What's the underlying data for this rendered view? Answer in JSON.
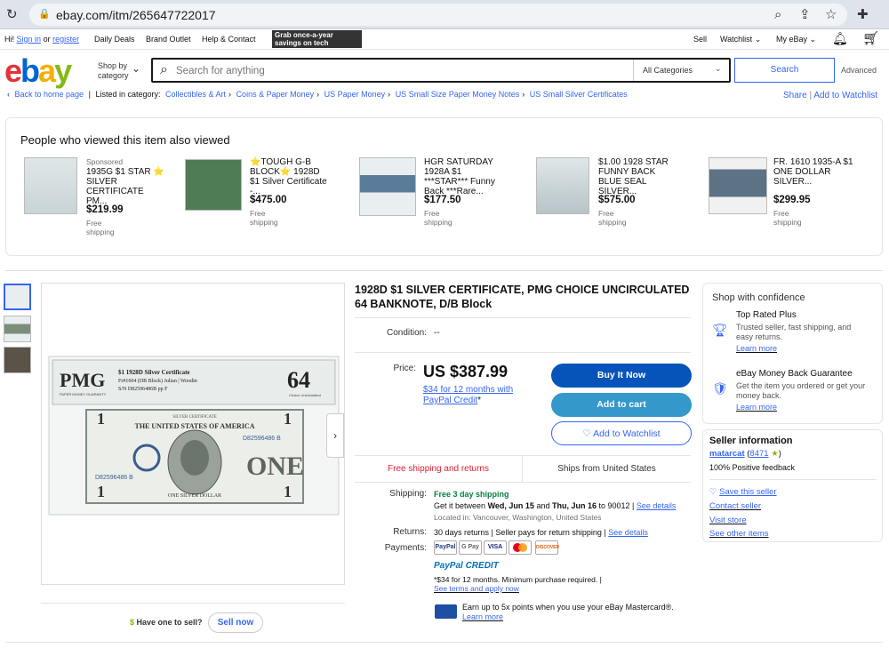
{
  "browser": {
    "url": "ebay.com/itm/265647722017"
  },
  "topnav": {
    "greeting": "Hi!",
    "sign_in": "Sign in",
    "or": "or",
    "register": "register",
    "daily_deals": "Daily Deals",
    "brand_outlet": "Brand Outlet",
    "help_contact": "Help & Contact",
    "promo_line1": "Grab once-a-year",
    "promo_line2": "savings on tech",
    "sell": "Sell",
    "watchlist": "Watchlist",
    "my_ebay": "My eBay"
  },
  "header": {
    "logo_letters": [
      "e",
      "b",
      "a",
      "y"
    ],
    "logo_colors": [
      "#e53238",
      "#0064d2",
      "#f5af02",
      "#86b817"
    ],
    "shop_by": "Shop by",
    "category": "category",
    "search_placeholder": "Search for anything",
    "all_categories": "All Categories",
    "search_button": "Search",
    "advanced": "Advanced"
  },
  "breadcrumbs": {
    "back": "Back to home page",
    "listed_in": "Listed in category:",
    "items": [
      "Collectibles & Art",
      "Coins & Paper Money",
      "US Paper Money",
      "US Small Size Paper Money Notes",
      "US Small Silver Certificates"
    ],
    "share": "Share",
    "add_watchlist": "Add to Watchlist"
  },
  "also_viewed": {
    "heading": "People who viewed this item also viewed",
    "items": [
      {
        "sponsored": "Sponsored",
        "title": "1935G $1 STAR ⭐ SILVER CERTIFICATE PM...",
        "price": "$219.99",
        "shipping": "Free shipping"
      },
      {
        "sponsored": "",
        "title": "⭐TOUGH G-B BLOCK⭐ 1928D $1 Silver Certificate -...",
        "price": "$475.00",
        "shipping": "Free shipping"
      },
      {
        "sponsored": "",
        "title": "HGR SATURDAY 1928A $1 ***STAR*** Funny Back ***Rare...",
        "price": "$177.50",
        "shipping": "Free shipping"
      },
      {
        "sponsored": "",
        "title": "$1.00 1928 STAR FUNNY BACK BLUE SEAL SILVER...",
        "price": "$575.00",
        "shipping": "Free shipping"
      },
      {
        "sponsored": "",
        "title": "FR. 1610 1935-A $1 ONE DOLLAR SILVER...",
        "price": "$299.95",
        "shipping": "Free shipping"
      }
    ]
  },
  "gallery": {
    "slab_brand": "PMG",
    "slab_title": "$1 1928D Silver Certificate",
    "slab_line2": "Fr#1604 (DB Block) Julian | Woodin",
    "slab_line3": "S/N D82596486B pp F",
    "slab_footer": "PAPER MONEY GUARANTY",
    "slab_grade": "64",
    "slab_grade_label": "Choice Uncirculated",
    "note_header": "SILVER CERTIFICATE",
    "note_serial": "D82596486 B",
    "note_country": "THE UNITED STATES OF AMERICA",
    "note_denomination": "ONE",
    "note_footer": "ONE SILVER DOLLAR",
    "have_one": "Have one to sell?",
    "sell_now": "Sell now"
  },
  "item": {
    "title": "1928D $1 SILVER CERTIFICATE, PMG CHOICE UNCIRCULATED 64 BANKNOTE, D/B Block",
    "condition_label": "Condition:",
    "condition_value": "--",
    "price_label": "Price:",
    "price": "US $387.99",
    "financing": "$34 for 12 months with PayPal Credit",
    "financing_mark": "*",
    "buy_now": "Buy It Now",
    "add_to_cart": "Add to cart",
    "add_to_watchlist": "♡ Add to Watchlist",
    "free_ship_returns": "Free shipping and returns",
    "ships_from": "Ships from United States",
    "shipping_label": "Shipping:",
    "shipping_speed": "Free 3 day shipping",
    "delivery_prefix": "Get it between",
    "delivery_start": "Wed, Jun 15",
    "delivery_and": "and",
    "delivery_end": "Thu, Jun 16",
    "delivery_suffix": "to 90012 |",
    "see_details": "See details",
    "located": "Located in: Vancouver, Washington, United States",
    "returns_label": "Returns:",
    "returns_text": "30 days returns | Seller pays for return shipping |",
    "payments_label": "Payments:",
    "payment_methods": [
      "PayPal",
      "G Pay",
      "VISA",
      "MC",
      "DISCOVER"
    ],
    "paypal_credit": "PayPal CREDIT",
    "credit_terms": "*$34 for 12 months. Minimum purchase required. |",
    "see_terms": "See terms and apply now",
    "mastercard_text": "Earn up to 5x points when you use your eBay Mastercard®.",
    "learn_more": "Learn more"
  },
  "confidence": {
    "heading": "Shop with confidence",
    "items": [
      {
        "title": "Top Rated Plus",
        "desc": "Trusted seller, fast shipping, and easy returns.",
        "link": "Learn more"
      },
      {
        "title": "eBay Money Back Guarantee",
        "desc": "Get the item you ordered or get your money back.",
        "link": "Learn more"
      }
    ]
  },
  "seller": {
    "heading": "Seller information",
    "name": "matarcat",
    "feedback_count": "8471",
    "positive": "100% Positive feedback",
    "save": "Save this seller",
    "contact": "Contact seller",
    "visit": "Visit store",
    "other": "See other items"
  }
}
